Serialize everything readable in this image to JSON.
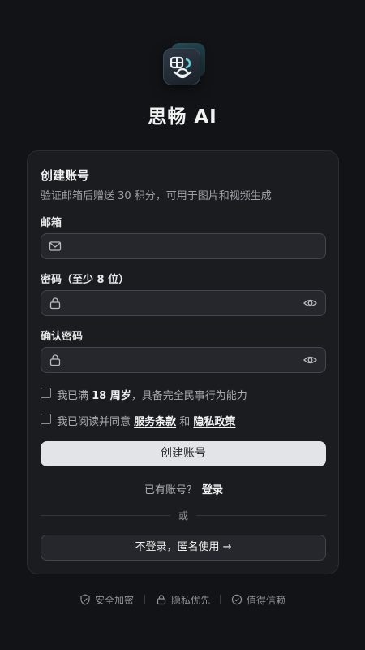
{
  "app": {
    "name": "思畅 AI"
  },
  "card": {
    "title": "创建账号",
    "subtitle": "验证邮箱后赠送 30 积分，可用于图片和视频生成"
  },
  "form": {
    "email": {
      "label": "邮箱",
      "value": "",
      "placeholder": ""
    },
    "password": {
      "label": "密码（至少 8 位）",
      "value": "",
      "placeholder": ""
    },
    "confirm": {
      "label": "确认密码",
      "value": "",
      "placeholder": ""
    }
  },
  "checks": {
    "age": {
      "prefix": "我已满 ",
      "bold": "18 周岁",
      "suffix": "，具备完全民事行为能力",
      "checked": false
    },
    "terms": {
      "prefix": "我已阅读并同意 ",
      "terms_link": "服务条款",
      "middle": " 和 ",
      "privacy_link": "隐私政策",
      "checked": false
    }
  },
  "actions": {
    "create": "创建账号",
    "have_account": "已有账号？",
    "login": "登录",
    "or": "或",
    "guest": "不登录，匿名使用 →"
  },
  "footer": {
    "security": "安全加密",
    "privacy": "隐私优先",
    "trust": "值得信赖"
  },
  "icons": {
    "email": "mail-icon",
    "password": "lock-icon",
    "toggle": "eye-icon",
    "security": "shield-icon",
    "privacy": "lock-icon",
    "trust": "check-circle-icon"
  }
}
